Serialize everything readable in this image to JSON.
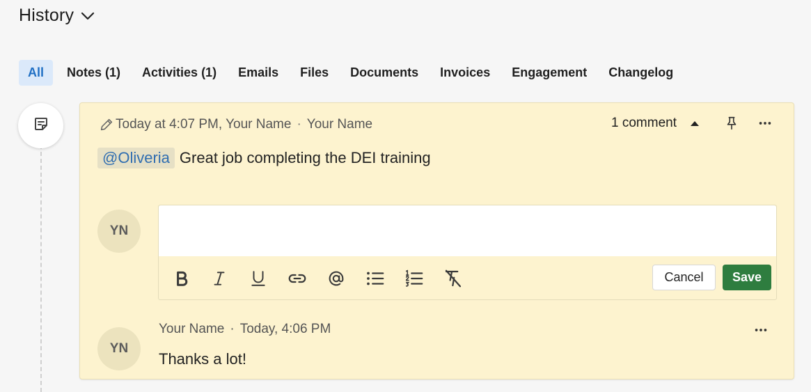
{
  "header": {
    "title": "History",
    "toggle_icon": "chevron-down-icon"
  },
  "tabs": [
    {
      "label": "All",
      "active": true
    },
    {
      "label": "Notes (1)"
    },
    {
      "label": "Activities (1)"
    },
    {
      "label": "Emails"
    },
    {
      "label": "Files"
    },
    {
      "label": "Documents"
    },
    {
      "label": "Invoices"
    },
    {
      "label": "Engagement"
    },
    {
      "label": "Changelog"
    }
  ],
  "timeline": {
    "node_icon": "note-icon"
  },
  "note": {
    "timestamp": "Today at 4:07 PM, Your Name",
    "author": "Your Name",
    "separator": "·",
    "comment_count": "1 comment",
    "mention": "@Oliveria",
    "text": "Great job completing the DEI training"
  },
  "composer": {
    "avatar_initials": "YN",
    "value": "",
    "toolbar": [
      "bold-icon",
      "italic-icon",
      "underline-icon",
      "link-icon",
      "mention-icon",
      "bullet-list-icon",
      "numbered-list-icon",
      "clear-format-icon"
    ],
    "cancel_label": "Cancel",
    "save_label": "Save"
  },
  "reply": {
    "avatar_initials": "YN",
    "author": "Your Name",
    "separator": "·",
    "time": "Today, 4:06 PM",
    "text": "Thanks a lot!"
  },
  "colors": {
    "accent_blue": "#1f6fc4",
    "note_background": "#fdf3cf",
    "save_green": "#2e7d3f"
  }
}
